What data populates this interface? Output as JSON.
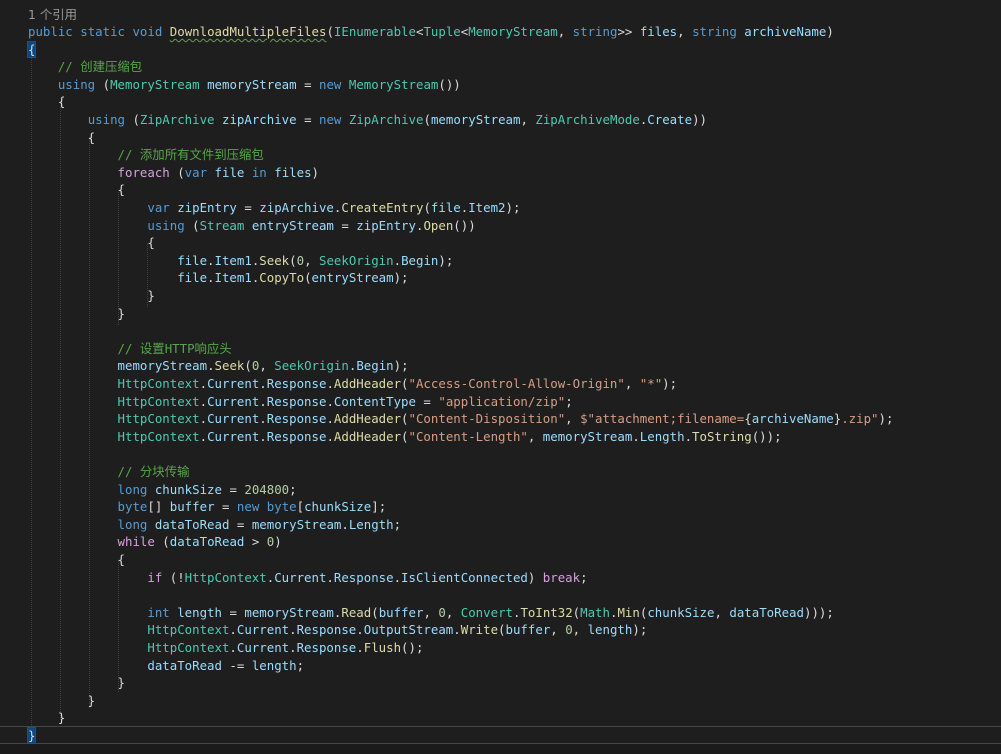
{
  "codelens": "1 个引用",
  "colors": {
    "background": "#1e1e1e",
    "keyword": "#569cd6",
    "control": "#d8a0df",
    "type": "#4ec9b0",
    "method": "#dcdcaa",
    "variable": "#9cdcfe",
    "comment": "#57a64a",
    "string": "#d69d85",
    "number": "#b5cea8",
    "plain": "#dcdcdc"
  },
  "lines": [
    [
      {
        "t": "public",
        "c": "keyword"
      },
      {
        "t": " "
      },
      {
        "t": "static",
        "c": "keyword"
      },
      {
        "t": " "
      },
      {
        "t": "void",
        "c": "keyword"
      },
      {
        "t": " "
      },
      {
        "t": "DownloadMultipleFiles",
        "c": "method",
        "sq": true
      },
      {
        "t": "("
      },
      {
        "t": "IEnumerable",
        "c": "type"
      },
      {
        "t": "<"
      },
      {
        "t": "Tuple",
        "c": "type"
      },
      {
        "t": "<"
      },
      {
        "t": "MemoryStream",
        "c": "type"
      },
      {
        "t": ", "
      },
      {
        "t": "string",
        "c": "keyword"
      },
      {
        "t": ">> "
      },
      {
        "t": "files",
        "c": "variable"
      },
      {
        "t": ", "
      },
      {
        "t": "string",
        "c": "keyword"
      },
      {
        "t": " "
      },
      {
        "t": "archiveName",
        "c": "variable"
      },
      {
        "t": ")"
      }
    ],
    [
      {
        "t": "{",
        "hl": true
      }
    ],
    [
      {
        "t": "    "
      },
      {
        "t": "// 创建压缩包",
        "c": "comment"
      }
    ],
    [
      {
        "t": "    "
      },
      {
        "t": "using",
        "c": "keyword"
      },
      {
        "t": " ("
      },
      {
        "t": "MemoryStream",
        "c": "type"
      },
      {
        "t": " "
      },
      {
        "t": "memoryStream",
        "c": "variable"
      },
      {
        "t": " = "
      },
      {
        "t": "new",
        "c": "keyword"
      },
      {
        "t": " "
      },
      {
        "t": "MemoryStream",
        "c": "type"
      },
      {
        "t": "())"
      }
    ],
    [
      {
        "t": "    {"
      }
    ],
    [
      {
        "t": "        "
      },
      {
        "t": "using",
        "c": "keyword"
      },
      {
        "t": " ("
      },
      {
        "t": "ZipArchive",
        "c": "type"
      },
      {
        "t": " "
      },
      {
        "t": "zipArchive",
        "c": "variable"
      },
      {
        "t": " = "
      },
      {
        "t": "new",
        "c": "keyword"
      },
      {
        "t": " "
      },
      {
        "t": "ZipArchive",
        "c": "type"
      },
      {
        "t": "("
      },
      {
        "t": "memoryStream",
        "c": "variable"
      },
      {
        "t": ", "
      },
      {
        "t": "ZipArchiveMode",
        "c": "type"
      },
      {
        "t": "."
      },
      {
        "t": "Create",
        "c": "variable"
      },
      {
        "t": "))"
      }
    ],
    [
      {
        "t": "        {"
      }
    ],
    [
      {
        "t": "            "
      },
      {
        "t": "// 添加所有文件到压缩包",
        "c": "comment"
      }
    ],
    [
      {
        "t": "            "
      },
      {
        "t": "foreach",
        "c": "control"
      },
      {
        "t": " ("
      },
      {
        "t": "var",
        "c": "keyword"
      },
      {
        "t": " "
      },
      {
        "t": "file",
        "c": "variable"
      },
      {
        "t": " "
      },
      {
        "t": "in",
        "c": "keyword"
      },
      {
        "t": " "
      },
      {
        "t": "files",
        "c": "variable"
      },
      {
        "t": ")"
      }
    ],
    [
      {
        "t": "            {"
      }
    ],
    [
      {
        "t": "                "
      },
      {
        "t": "var",
        "c": "keyword"
      },
      {
        "t": " "
      },
      {
        "t": "zipEntry",
        "c": "variable"
      },
      {
        "t": " = "
      },
      {
        "t": "zipArchive",
        "c": "variable"
      },
      {
        "t": "."
      },
      {
        "t": "CreateEntry",
        "c": "method"
      },
      {
        "t": "("
      },
      {
        "t": "file",
        "c": "variable"
      },
      {
        "t": "."
      },
      {
        "t": "Item2",
        "c": "variable"
      },
      {
        "t": ");"
      }
    ],
    [
      {
        "t": "                "
      },
      {
        "t": "using",
        "c": "keyword"
      },
      {
        "t": " ("
      },
      {
        "t": "Stream",
        "c": "type"
      },
      {
        "t": " "
      },
      {
        "t": "entryStream",
        "c": "variable"
      },
      {
        "t": " = "
      },
      {
        "t": "zipEntry",
        "c": "variable"
      },
      {
        "t": "."
      },
      {
        "t": "Open",
        "c": "method"
      },
      {
        "t": "())"
      }
    ],
    [
      {
        "t": "                {"
      }
    ],
    [
      {
        "t": "                    "
      },
      {
        "t": "file",
        "c": "variable"
      },
      {
        "t": "."
      },
      {
        "t": "Item1",
        "c": "variable"
      },
      {
        "t": "."
      },
      {
        "t": "Seek",
        "c": "method"
      },
      {
        "t": "("
      },
      {
        "t": "0",
        "c": "number"
      },
      {
        "t": ", "
      },
      {
        "t": "SeekOrigin",
        "c": "type"
      },
      {
        "t": "."
      },
      {
        "t": "Begin",
        "c": "variable"
      },
      {
        "t": ");"
      }
    ],
    [
      {
        "t": "                    "
      },
      {
        "t": "file",
        "c": "variable"
      },
      {
        "t": "."
      },
      {
        "t": "Item1",
        "c": "variable"
      },
      {
        "t": "."
      },
      {
        "t": "CopyTo",
        "c": "method"
      },
      {
        "t": "("
      },
      {
        "t": "entryStream",
        "c": "variable"
      },
      {
        "t": ");"
      }
    ],
    [
      {
        "t": "                }"
      }
    ],
    [
      {
        "t": "            }"
      }
    ],
    [],
    [
      {
        "t": "            "
      },
      {
        "t": "// 设置HTTP响应头",
        "c": "comment"
      }
    ],
    [
      {
        "t": "            "
      },
      {
        "t": "memoryStream",
        "c": "variable"
      },
      {
        "t": "."
      },
      {
        "t": "Seek",
        "c": "method"
      },
      {
        "t": "("
      },
      {
        "t": "0",
        "c": "number"
      },
      {
        "t": ", "
      },
      {
        "t": "SeekOrigin",
        "c": "type"
      },
      {
        "t": "."
      },
      {
        "t": "Begin",
        "c": "variable"
      },
      {
        "t": ");"
      }
    ],
    [
      {
        "t": "            "
      },
      {
        "t": "HttpContext",
        "c": "type"
      },
      {
        "t": "."
      },
      {
        "t": "Current",
        "c": "variable"
      },
      {
        "t": "."
      },
      {
        "t": "Response",
        "c": "variable"
      },
      {
        "t": "."
      },
      {
        "t": "AddHeader",
        "c": "method"
      },
      {
        "t": "("
      },
      {
        "t": "\"Access-Control-Allow-Origin\"",
        "c": "string"
      },
      {
        "t": ", "
      },
      {
        "t": "\"*\"",
        "c": "string"
      },
      {
        "t": ");"
      }
    ],
    [
      {
        "t": "            "
      },
      {
        "t": "HttpContext",
        "c": "type"
      },
      {
        "t": "."
      },
      {
        "t": "Current",
        "c": "variable"
      },
      {
        "t": "."
      },
      {
        "t": "Response",
        "c": "variable"
      },
      {
        "t": "."
      },
      {
        "t": "ContentType",
        "c": "variable"
      },
      {
        "t": " = "
      },
      {
        "t": "\"application/zip\"",
        "c": "string"
      },
      {
        "t": ";"
      }
    ],
    [
      {
        "t": "            "
      },
      {
        "t": "HttpContext",
        "c": "type"
      },
      {
        "t": "."
      },
      {
        "t": "Current",
        "c": "variable"
      },
      {
        "t": "."
      },
      {
        "t": "Response",
        "c": "variable"
      },
      {
        "t": "."
      },
      {
        "t": "AddHeader",
        "c": "method"
      },
      {
        "t": "("
      },
      {
        "t": "\"Content-Disposition\"",
        "c": "string"
      },
      {
        "t": ", "
      },
      {
        "t": "$\"attachment;filename=",
        "c": "string"
      },
      {
        "t": "{"
      },
      {
        "t": "archiveName",
        "c": "variable"
      },
      {
        "t": "}"
      },
      {
        "t": ".zip\"",
        "c": "string"
      },
      {
        "t": ");"
      }
    ],
    [
      {
        "t": "            "
      },
      {
        "t": "HttpContext",
        "c": "type"
      },
      {
        "t": "."
      },
      {
        "t": "Current",
        "c": "variable"
      },
      {
        "t": "."
      },
      {
        "t": "Response",
        "c": "variable"
      },
      {
        "t": "."
      },
      {
        "t": "AddHeader",
        "c": "method"
      },
      {
        "t": "("
      },
      {
        "t": "\"Content-Length\"",
        "c": "string"
      },
      {
        "t": ", "
      },
      {
        "t": "memoryStream",
        "c": "variable"
      },
      {
        "t": "."
      },
      {
        "t": "Length",
        "c": "variable"
      },
      {
        "t": "."
      },
      {
        "t": "ToString",
        "c": "method"
      },
      {
        "t": "());"
      }
    ],
    [],
    [
      {
        "t": "            "
      },
      {
        "t": "// 分块传输",
        "c": "comment"
      }
    ],
    [
      {
        "t": "            "
      },
      {
        "t": "long",
        "c": "keyword"
      },
      {
        "t": " "
      },
      {
        "t": "chunkSize",
        "c": "variable"
      },
      {
        "t": " = "
      },
      {
        "t": "204800",
        "c": "number"
      },
      {
        "t": ";"
      }
    ],
    [
      {
        "t": "            "
      },
      {
        "t": "byte",
        "c": "keyword"
      },
      {
        "t": "[] "
      },
      {
        "t": "buffer",
        "c": "variable"
      },
      {
        "t": " = "
      },
      {
        "t": "new",
        "c": "keyword"
      },
      {
        "t": " "
      },
      {
        "t": "byte",
        "c": "keyword"
      },
      {
        "t": "["
      },
      {
        "t": "chunkSize",
        "c": "variable"
      },
      {
        "t": "];"
      }
    ],
    [
      {
        "t": "            "
      },
      {
        "t": "long",
        "c": "keyword"
      },
      {
        "t": " "
      },
      {
        "t": "dataToRead",
        "c": "variable"
      },
      {
        "t": " = "
      },
      {
        "t": "memoryStream",
        "c": "variable"
      },
      {
        "t": "."
      },
      {
        "t": "Length",
        "c": "variable"
      },
      {
        "t": ";"
      }
    ],
    [
      {
        "t": "            "
      },
      {
        "t": "while",
        "c": "control"
      },
      {
        "t": " ("
      },
      {
        "t": "dataToRead",
        "c": "variable"
      },
      {
        "t": " > "
      },
      {
        "t": "0",
        "c": "number"
      },
      {
        "t": ")"
      }
    ],
    [
      {
        "t": "            {"
      }
    ],
    [
      {
        "t": "                "
      },
      {
        "t": "if",
        "c": "control"
      },
      {
        "t": " (!"
      },
      {
        "t": "HttpContext",
        "c": "type"
      },
      {
        "t": "."
      },
      {
        "t": "Current",
        "c": "variable"
      },
      {
        "t": "."
      },
      {
        "t": "Response",
        "c": "variable"
      },
      {
        "t": "."
      },
      {
        "t": "IsClientConnected",
        "c": "variable"
      },
      {
        "t": ") "
      },
      {
        "t": "break",
        "c": "control"
      },
      {
        "t": ";"
      }
    ],
    [],
    [
      {
        "t": "                "
      },
      {
        "t": "int",
        "c": "keyword"
      },
      {
        "t": " "
      },
      {
        "t": "length",
        "c": "variable"
      },
      {
        "t": " = "
      },
      {
        "t": "memoryStream",
        "c": "variable"
      },
      {
        "t": "."
      },
      {
        "t": "Read",
        "c": "method"
      },
      {
        "t": "("
      },
      {
        "t": "buffer",
        "c": "variable"
      },
      {
        "t": ", "
      },
      {
        "t": "0",
        "c": "number"
      },
      {
        "t": ", "
      },
      {
        "t": "Convert",
        "c": "type"
      },
      {
        "t": "."
      },
      {
        "t": "ToInt32",
        "c": "method"
      },
      {
        "t": "("
      },
      {
        "t": "Math",
        "c": "type"
      },
      {
        "t": "."
      },
      {
        "t": "Min",
        "c": "method"
      },
      {
        "t": "("
      },
      {
        "t": "chunkSize",
        "c": "variable"
      },
      {
        "t": ", "
      },
      {
        "t": "dataToRead",
        "c": "variable"
      },
      {
        "t": ")));"
      }
    ],
    [
      {
        "t": "                "
      },
      {
        "t": "HttpContext",
        "c": "type"
      },
      {
        "t": "."
      },
      {
        "t": "Current",
        "c": "variable"
      },
      {
        "t": "."
      },
      {
        "t": "Response",
        "c": "variable"
      },
      {
        "t": "."
      },
      {
        "t": "OutputStream",
        "c": "variable"
      },
      {
        "t": "."
      },
      {
        "t": "Write",
        "c": "method"
      },
      {
        "t": "("
      },
      {
        "t": "buffer",
        "c": "variable"
      },
      {
        "t": ", "
      },
      {
        "t": "0",
        "c": "number"
      },
      {
        "t": ", "
      },
      {
        "t": "length",
        "c": "variable"
      },
      {
        "t": ");"
      }
    ],
    [
      {
        "t": "                "
      },
      {
        "t": "HttpContext",
        "c": "type"
      },
      {
        "t": "."
      },
      {
        "t": "Current",
        "c": "variable"
      },
      {
        "t": "."
      },
      {
        "t": "Response",
        "c": "variable"
      },
      {
        "t": "."
      },
      {
        "t": "Flush",
        "c": "method"
      },
      {
        "t": "();"
      }
    ],
    [
      {
        "t": "                "
      },
      {
        "t": "dataToRead",
        "c": "variable"
      },
      {
        "t": " -= "
      },
      {
        "t": "length",
        "c": "variable"
      },
      {
        "t": ";"
      }
    ],
    [
      {
        "t": "            }"
      }
    ],
    [
      {
        "t": "        }"
      }
    ],
    [
      {
        "t": "    }"
      }
    ],
    [
      {
        "t": "}",
        "hl": true
      }
    ]
  ]
}
